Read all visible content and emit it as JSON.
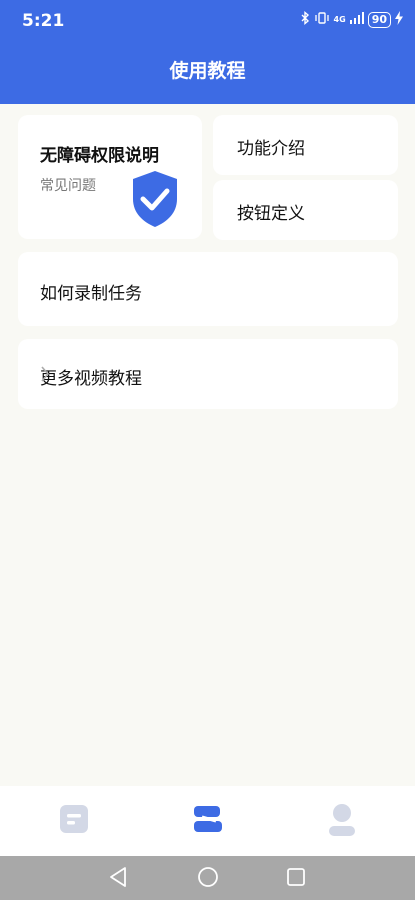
{
  "status": {
    "time": "5:21",
    "battery": "90",
    "network": "4G"
  },
  "header": {
    "title": "使用教程"
  },
  "cards": {
    "accessibility": {
      "title": "无障碍权限说明",
      "subtitle": "常见问题"
    },
    "features": {
      "label": "功能介绍"
    },
    "buttons": {
      "label": "按钮定义"
    },
    "record": {
      "label": "如何录制任务"
    },
    "videos": {
      "label": "更多视频教程"
    }
  },
  "colors": {
    "accent": "#3d6be4",
    "background": "#f9f9f4",
    "inactive_icon": "#d3d8e6"
  },
  "tabs": {
    "items": [
      "document-icon",
      "tutorial-icon",
      "profile-icon"
    ],
    "active": "tutorial-icon"
  }
}
